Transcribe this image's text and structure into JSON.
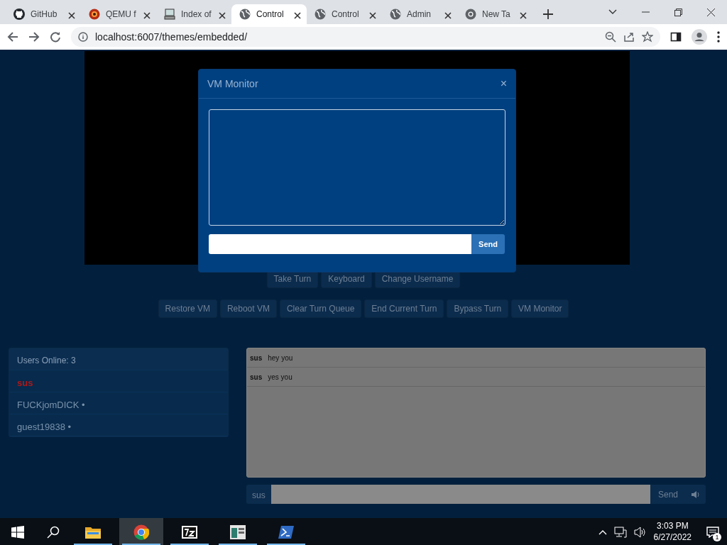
{
  "browser": {
    "tabs": [
      {
        "title": "GitHub",
        "kind": "github",
        "selected": false
      },
      {
        "title": "QEMU f",
        "kind": "qemu",
        "selected": false
      },
      {
        "title": "Index of",
        "kind": "index",
        "selected": false
      },
      {
        "title": "Control",
        "kind": "globe",
        "selected": true
      },
      {
        "title": "Control",
        "kind": "globe",
        "selected": false
      },
      {
        "title": "Admin",
        "kind": "globe",
        "selected": false
      },
      {
        "title": "New Ta",
        "kind": "chrome",
        "selected": false
      }
    ],
    "address": "localhost:6007/themes/embedded/"
  },
  "controls_row1": [
    "Take Turn",
    "Keyboard",
    "Change Username"
  ],
  "controls_row2": [
    "Restore VM",
    "Reboot VM",
    "Clear Turn Queue",
    "End Current Turn",
    "Bypass Turn",
    "VM Monitor"
  ],
  "users": {
    "header": "Users Online: 3",
    "items": [
      {
        "name": "sus",
        "color": "#b01818"
      },
      {
        "name": "FUCKjomDICK •",
        "color": "#7a93ad"
      },
      {
        "name": "guest19838 •",
        "color": "#7a93ad"
      }
    ]
  },
  "chat": {
    "messages": [
      {
        "user": "sus",
        "text": "hey you"
      },
      {
        "user": "sus",
        "text": "yes you"
      }
    ],
    "username": "sus",
    "send": "Send"
  },
  "modal": {
    "title": "VM Monitor",
    "close": "×",
    "send": "Send"
  },
  "taskbar": {
    "apps": [
      {
        "kind": "explorer",
        "running": true,
        "selected": false
      },
      {
        "kind": "chrome",
        "running": true,
        "selected": true
      },
      {
        "kind": "sevenzip",
        "running": true,
        "selected": false
      },
      {
        "kind": "window",
        "running": true,
        "selected": false
      },
      {
        "kind": "terminal",
        "running": true,
        "selected": false
      }
    ],
    "time": "3:03 PM",
    "date": "6/27/2022",
    "notifications": "1"
  }
}
